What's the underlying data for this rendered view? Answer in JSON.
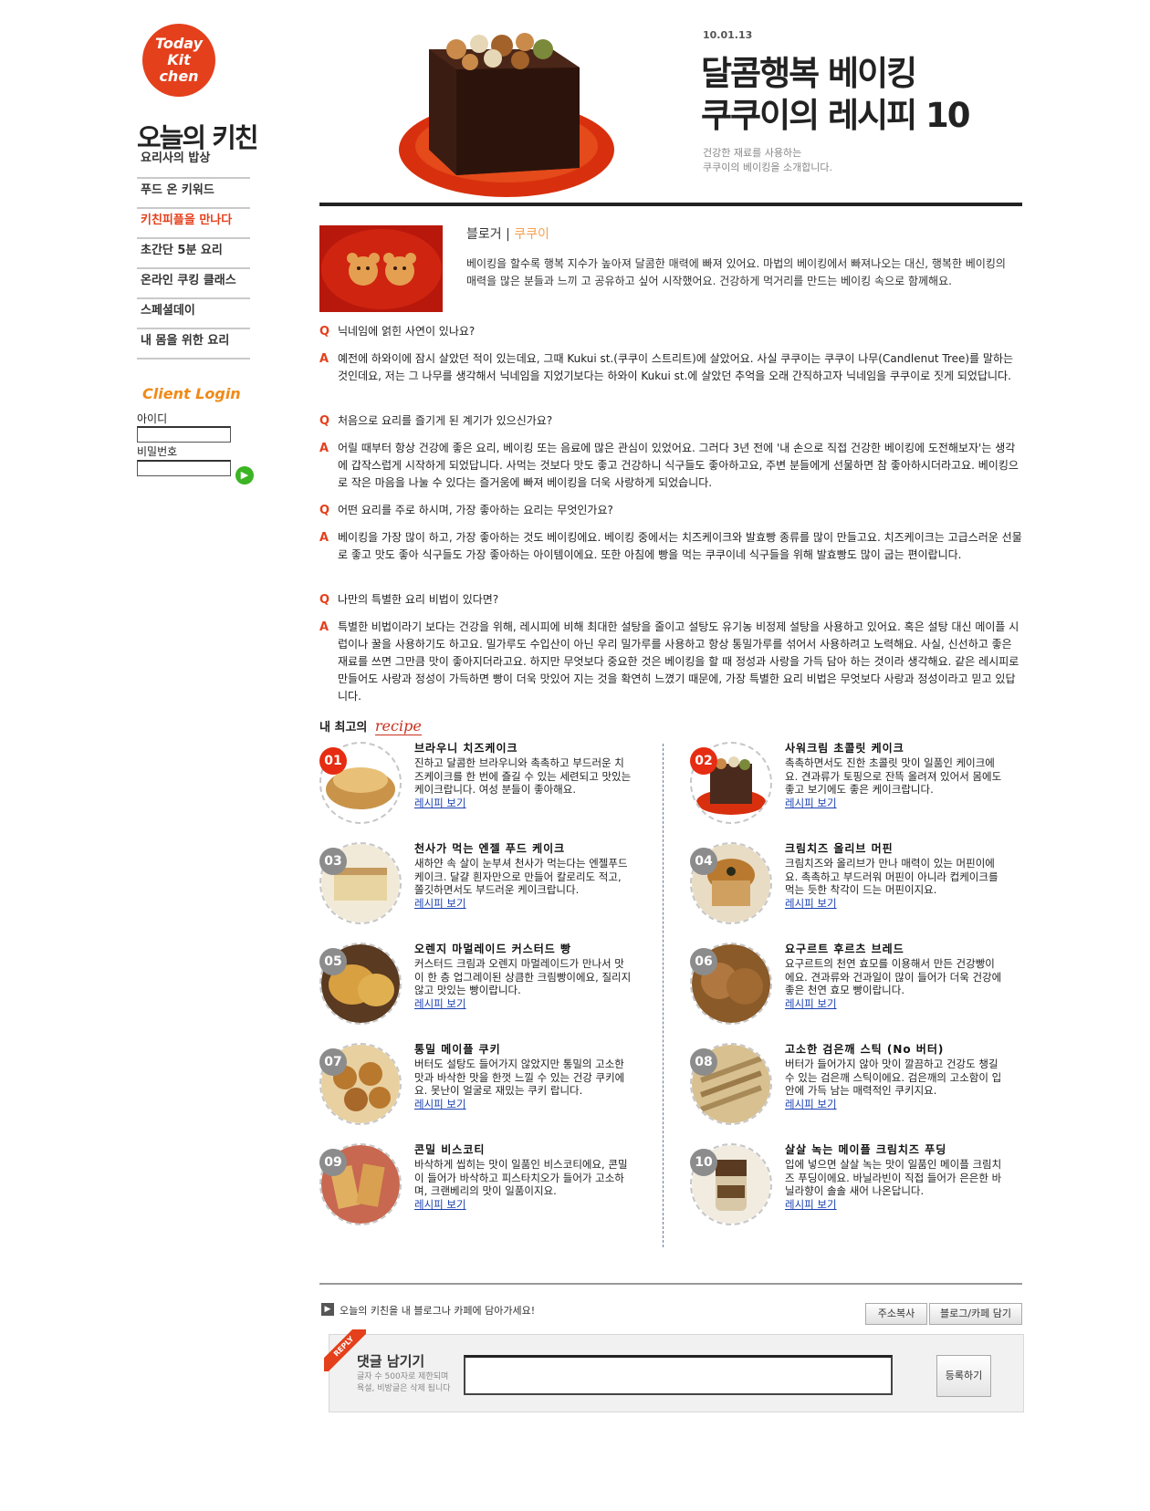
{
  "logo": {
    "line1": "Today",
    "line2": "Kit",
    "line3": "chen"
  },
  "sidebar": {
    "title": "오늘의 키친",
    "items": [
      {
        "label": "요리사의 밥상"
      },
      {
        "label": "푸드 온 키워드"
      },
      {
        "label": "키친피플을 만나다"
      },
      {
        "label": "초간단 5분 요리"
      },
      {
        "label": "온라인 쿠킹 클래스"
      },
      {
        "label": "스페셜데이"
      },
      {
        "label": "내 몸을 위한 요리"
      }
    ],
    "active_index": 2,
    "login": {
      "title": "Client Login",
      "id_label": "아이디",
      "pw_label": "비밀번호"
    }
  },
  "header": {
    "date": "10.01.13",
    "headline1": "달콤행복 베이킹",
    "headline2": "쿠쿠이의 레시피 10",
    "sub1": "건강한 재료를 사용하는",
    "sub2": "쿠쿠이의 베이킹을 소개합니다."
  },
  "intro": {
    "blogger_label": "블로거 |",
    "blogger_name": "쿠쿠이",
    "text": "베이킹을 할수록 행복 지수가 높아져 달콤한 매력에 빠져 있어요. 마법의 베이킹에서 빠져나오는 대신, 행복한 베이킹의 매력을 많은 분들과 느끼 고 공유하고 싶어 시작했어요. 건강하게 먹거리를 만드는 베이킹 속으로 함께해요."
  },
  "qa": [
    {
      "mark": "Q",
      "text": "닉네임에 얽힌 사연이 있나요?"
    },
    {
      "mark": "A",
      "text": "예전에 하와이에 잠시 살았던 적이 있는데요, 그때 Kukui st.(쿠쿠이 스트리트)에 살았어요. 사실 쿠쿠이는 쿠쿠이 나무(Candlenut Tree)를 말하는 것인데요, 저는 그 나무를 생각해서 닉네임을 지었기보다는 하와이 Kukui st.에 살았던 추억을 오래 간직하고자 닉네임을 쿠쿠이로 짓게 되었답니다."
    },
    {
      "mark": "Q",
      "text": "처음으로 요리를 즐기게 된 계기가 있으신가요?"
    },
    {
      "mark": "A",
      "text": "어릴 때부터 항상 건강에 좋은 요리, 베이킹 또는 음료에 많은 관심이 있었어요. 그러다 3년 전에 '내 손으로 직접 건강한 베이킹에 도전해보자'는 생각에 갑작스럽게 시작하게 되었답니다. 사먹는 것보다 맛도 좋고 건강하니 식구들도 좋아하고요, 주변 분들에게 선물하면 참 좋아하시더라고요. 베이킹으로 작은 마음을 나눌 수 있다는 즐거움에 빠져 베이킹을 더욱 사랑하게 되었습니다."
    },
    {
      "mark": "Q",
      "text": "어떤 요리를 주로 하시며, 가장 좋아하는 요리는 무엇인가요?"
    },
    {
      "mark": "A",
      "text": "베이킹을 가장 많이 하고, 가장 좋아하는 것도 베이킹에요. 베이킹 중에서는 치즈케이크와 발효빵 종류를 많이 만들고요. 치즈케이크는 고급스러운 선물로 좋고 맛도 좋아 식구들도 가장 좋아하는 아이템이에요. 또한 아침에 빵을 먹는 쿠쿠이네 식구들을 위해 발효빵도 많이 굽는 편이랍니다."
    },
    {
      "mark": "Q",
      "text": "나만의 특별한 요리 비법이 있다면?"
    },
    {
      "mark": "A",
      "text": "특별한 비법이라기 보다는 건강을 위해, 레시피에 비해 최대한 설탕을 줄이고 설탕도 유기농 비정제 설탕을 사용하고 있어요. 혹은 설탕 대신 메이플 시럽이나 꿀을 사용하기도 하고요. 밀가루도 수입산이 아닌 우리 밀가루를 사용하고 항상 통밀가루를 섞어서 사용하려고 노력해요. 사실, 신선하고 좋은 재료를 쓰면 그만큼 맛이 좋아지더라고요. 하지만 무엇보다 중요한 것은 베이킹을 할 때 정성과 사랑을 가득 담아 하는 것이라 생각해요. 같은 레시피로 만들어도 사랑과 정성이 가득하면 빵이 더욱 맛있어 지는 것을 확연히 느꼈기 때문에, 가장 특별한 요리 비법은 무엇보다 사랑과 정성이라고 믿고 있답니다."
    }
  ],
  "recipes_heading": {
    "prefix": "내 최고의",
    "script": "recipe"
  },
  "recipes": [
    {
      "num": "01",
      "title": "브라우니 치즈케이크",
      "desc": "진하고 달콤한 브라우니와 촉촉하고 부드러운 치즈케이크를 한 번에 즐길 수 있는 세련되고 맛있는 케이크랍니다. 여성 분들이 좋아해요.",
      "link": "레시피 보기",
      "color": "#c9944a"
    },
    {
      "num": "02",
      "title": "사워크림 초콜릿 케이크",
      "desc": "촉촉하면서도 진한 초콜릿 맛이 일품인 케이크에요. 견과류가 토핑으로 잔뜩 올려져 있어서 몸에도 좋고 보기에도 좋은 케이크랍니다.",
      "link": "레시피 보기",
      "color": "#4a2a1c"
    },
    {
      "num": "03",
      "title": "천사가 먹는 엔젤 푸드 케이크",
      "desc": "새하얀 속 살이 눈부셔 천사가 먹는다는 엔젤푸드 케이크. 달걀 흰자만으로 만들어 칼로리도 적고, 쫄깃하면서도 부드러운 케이크랍니다.",
      "link": "레시피 보기",
      "color": "#c49a5e"
    },
    {
      "num": "04",
      "title": "크림치즈 올리브 머핀",
      "desc": "크림치즈와 올리브가 만나 매력이 있는 머핀이에요. 촉촉하고 부드러워 머핀이 아니라 컵케이크를 먹는 듯한 착각이 드는 머핀이지요.",
      "link": "레시피 보기",
      "color": "#b97a30"
    },
    {
      "num": "05",
      "title": "오렌지 마멀레이드 커스터드 빵",
      "desc": "커스터드 크림과 오렌지 마멀레이드가 만나서 맛이 한 층 업그레이된 상큼한 크림빵이에요, 질리지 않고 맛있는 빵이랍니다.",
      "link": "레시피 보기",
      "color": "#d8a040"
    },
    {
      "num": "06",
      "title": "요구르트 후르츠 브레드",
      "desc": "요구르트의 천연 효모를 이용해서 만든 건강빵이에요. 견과류와 건과일이 많이 들어가 더욱 건강에 좋은 천연 효모 빵이랍니다.",
      "link": "레시피 보기",
      "color": "#9a6a38"
    },
    {
      "num": "07",
      "title": "통밀 메이플 쿠키",
      "desc": "버터도 설탕도 들어가지 않았지만 통밀의 고소한 맛과 바삭한 맛을 한껏 느낄 수 있는 건강 쿠키에요. 못난이 얼굴로 재밌는 쿠키 랍니다.",
      "link": "레시피 보기",
      "color": "#b8782e"
    },
    {
      "num": "08",
      "title": "고소한 검은깨 스틱 (No 버터)",
      "desc": "버터가 들어가지 않아 맛이 깔끔하고 건강도 챙길 수 있는 검은깨 스틱이에요. 검은깨의 고소함이 입 안에 가득 남는 매력적인 쿠키지요.",
      "link": "레시피 보기",
      "color": "#a88a58"
    },
    {
      "num": "09",
      "title": "콘밀 비스코티",
      "desc": "바삭하게 씹히는 맛이 일품인 비스코티에요, 콘밀이 들어가 바삭하고 피스타치오가 들어가 고소하며, 크랜베리의 맛이 일품이지요.",
      "link": "레시피 보기",
      "color": "#c6863c"
    },
    {
      "num": "10",
      "title": "살살 녹는 메이플 크림치즈 푸딩",
      "desc": "입에 넣으면 살살 녹는 맛이 일품인 메이플 크림치즈 푸딩이에요. 바닐라빈이 직접 들어가 은은한 바닐라향이 솔솔 새어 나온답니다.",
      "link": "레시피 보기",
      "color": "#d8c8a8"
    }
  ],
  "share": {
    "text": "오늘의 키친을 내 블로그나 카페에 담아가세요!",
    "copy_btn": "주소복사",
    "blog_btn": "블로그/카페 담기"
  },
  "reply": {
    "ribbon": "REPLY",
    "title": "댓글 남기기",
    "note1": "글자 수 500자로 제한되며",
    "note2": "욕설, 비방글은 삭제 됩니다",
    "submit": "등록하기"
  }
}
